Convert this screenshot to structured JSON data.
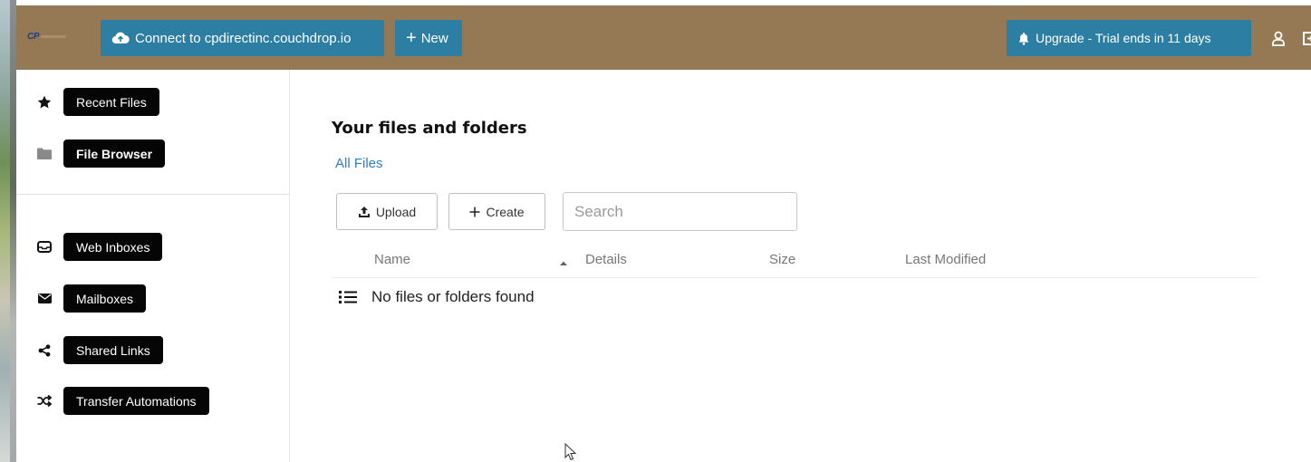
{
  "header": {
    "logo_text": "CP",
    "connect_label": "Connect to cpdirectinc.couchdrop.io",
    "new_label": "New",
    "upgrade_label": "Upgrade - Trial ends in 11 days"
  },
  "sidebar": {
    "items": [
      {
        "label": "Recent Files",
        "icon": "star-icon"
      },
      {
        "label": "File Browser",
        "icon": "folder-icon"
      },
      {
        "label": "Web Inboxes",
        "icon": "inbox-icon"
      },
      {
        "label": "Mailboxes",
        "icon": "envelope-icon"
      },
      {
        "label": "Shared Links",
        "icon": "share-icon"
      },
      {
        "label": "Transfer Automations",
        "icon": "shuffle-icon"
      }
    ]
  },
  "main": {
    "title": "Your files and folders",
    "breadcrumb": "All Files",
    "upload_label": "Upload",
    "create_label": "Create",
    "search_placeholder": "Search",
    "columns": [
      "Name",
      "Details",
      "Size",
      "Last Modified"
    ],
    "empty_message": "No files or folders found"
  },
  "colors": {
    "header_bg": "#957854",
    "button_blue": "#2c7ea3",
    "link_blue": "#2c7ec4",
    "pill_bg": "#050505"
  }
}
